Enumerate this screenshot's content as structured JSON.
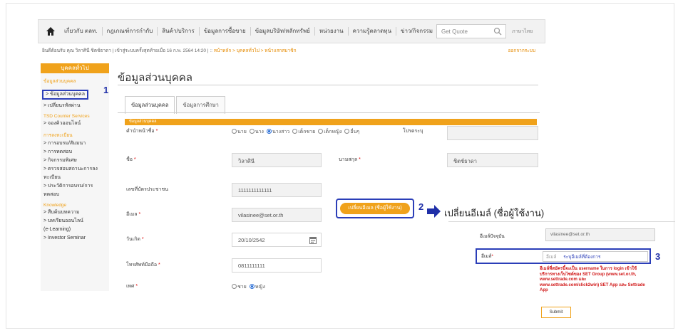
{
  "nav": {
    "items": [
      "เกี่ยวกับ ตลท.",
      "กฎเกณฑ์การกำกับ",
      "สินค้า/บริการ",
      "ข้อมูลการซื้อขาย",
      "ข้อมูลบริษัท/หลักทรัพย์",
      "หน่วยงาน",
      "ความรู้ตลาดทุน",
      "ข่าว/กิจกรรม"
    ],
    "quote_placeholder": "Get Quote",
    "lang": "ภาษาไทย"
  },
  "welcome": {
    "text": "ยินดีต้อนรับ คุณ วิลาศินี ชิตช์ธาดา | เข้าสู่ระบบครั้งสุดท้ายเมื่อ 16 ก.พ. 2564 14:20 | ::",
    "breadcrumb": "หน้าหลัก > บุคคลทั่วไป > หน้าแรกสมาชิก",
    "logout": "ออกจากระบบ"
  },
  "sidebar": {
    "header": "บุคคลทั่วไป",
    "section1": "ข้อมูลส่วนบุคคล",
    "item_personal": "> ข้อมูลส่วนบุคคล",
    "item_password": "> เปลี่ยนรหัสผ่าน",
    "section2": "TSD Counter Services",
    "item_queue": "> จองคิวออนไลน์",
    "section3": "การลงทะเบียน",
    "item_training": "> การอบรม/สัมมนา",
    "item_exam": "> การทดสอบ",
    "item_activity": "> กิจกรรมพิเศษ",
    "item_check1": "> ตรวจสอบสถานะการลง",
    "item_check2": "ทะเบียน",
    "item_history1": "> ประวัติการอบรม/การ",
    "item_history2": "ทดสอบ",
    "section4": "Knowledge",
    "item_library": "> สืบค้นบทความ",
    "item_online1": "> บทเรียนออนไลน์",
    "item_online2": "(e-Learning)",
    "item_seminar": "> Investor Seminar"
  },
  "steps": {
    "one": "1",
    "two": "2",
    "three": "3"
  },
  "main": {
    "title": "ข้อมูลส่วนบุคคล",
    "tab_personal": "ข้อมูลส่วนบุคคล",
    "tab_education": "ข้อมูลการศึกษา",
    "section": "ข้อมูลส่วนบุคคล",
    "prefix_label": "คำนำหน้าชื่อ",
    "prefix_options": [
      "นาย",
      "นาง",
      "นางสาว",
      "เด็กชาย",
      "เด็กหญิง",
      "อื่นๆ"
    ],
    "prefix_selected_index": 2,
    "other_label": "โปรดระบุ",
    "name_label": "ชื่อ",
    "name_value": "วิลาศินี",
    "surname_label": "นามสกุล",
    "surname_value": "ชิตช์ธาดา",
    "id_label": "เลขที่บัตรประชาชน",
    "id_value": "1111111111111",
    "email_label": "อีเมล",
    "email_value": "vilasinee@set.or.th",
    "change_email_button": "เปลี่ยนอีเมล (ชื่อผู้ใช้งาน)",
    "dob_label": "วันเกิด",
    "dob_value": "20/10/2542",
    "phone_label": "โทรศัพท์มือถือ",
    "phone_value": "0811111111",
    "gender_label": "เพศ",
    "gender_options": [
      "ชาย",
      "หญิง"
    ],
    "gender_selected_index": 1
  },
  "popup": {
    "title": "เปลี่ยนอีเมล์ (ชื่อผู้ใช้งาน)",
    "current_label": "อีเมล์ปัจจุบัน",
    "current_value": "vilasinee@set.or.th",
    "new_label": "อีเมล์",
    "new_placeholder": "อีเมล์",
    "new_hint": "ระบุอีเมล์ที่ต้องการ",
    "note": "อีเมล์ที่สมัครนี้จะเป็น username ในการ login เข้าใช้บริการทางเว็บไซต์ของ SET Group (www.set.or.th, www.settrade.com และ www.settrade.com/click2win) SET App และ Settrade App",
    "submit": "Submit"
  },
  "colors": {
    "accent": "#f0a21b",
    "highlight": "#2b3eb8",
    "warning": "#d01515"
  }
}
